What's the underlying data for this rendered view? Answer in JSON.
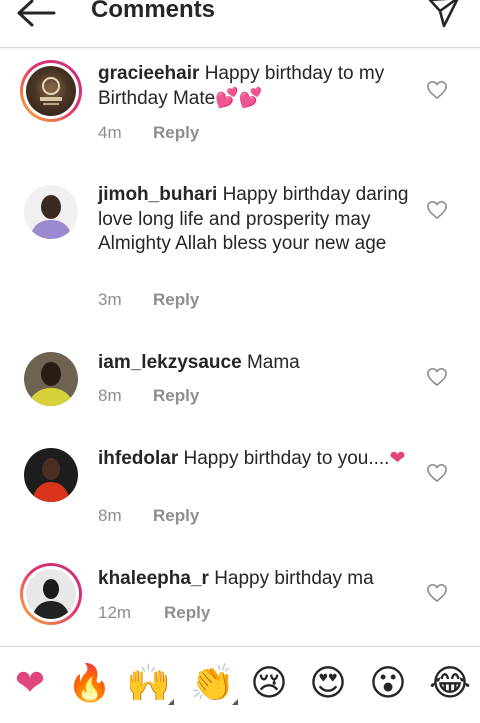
{
  "header": {
    "title": "Comments",
    "back_icon": "arrow-left-icon",
    "send_icon": "paper-plane-icon"
  },
  "comments": [
    {
      "username": "gracieehair",
      "text": "Happy birthday to my Birthday Mate",
      "emoji": "💕💕",
      "time": "4m",
      "reply_label": "Reply"
    },
    {
      "username": "jimoh_buhari",
      "text": "Happy birthday daring love long life and prosperity may Almighty Allah bless your new age",
      "emoji": "",
      "time": "3m",
      "reply_label": "Reply"
    },
    {
      "username": "iam_lekzysauce",
      "text": "Mama",
      "emoji": "",
      "time": "8m",
      "reply_label": "Reply"
    },
    {
      "username": "ihfedolar",
      "text": "Happy birthday to you....",
      "emoji": "❤",
      "time": "8m",
      "reply_label": "Reply"
    },
    {
      "username": "khaleepha_r",
      "text": "Happy birthday ma",
      "emoji": "",
      "time": "12m",
      "reply_label": "Reply"
    }
  ],
  "emoji_bar": [
    {
      "glyph": "❤",
      "name": "heart-emoji",
      "variants": false
    },
    {
      "glyph": "🔥",
      "name": "fire-emoji",
      "variants": false
    },
    {
      "glyph": "🙌",
      "name": "raised-hands-emoji",
      "variants": true
    },
    {
      "glyph": "👏",
      "name": "clapping-hands-emoji",
      "variants": true
    },
    {
      "glyph": "😢",
      "name": "sad-face-emoji",
      "variants": false
    },
    {
      "glyph": "😍",
      "name": "heart-eyes-emoji",
      "variants": false
    },
    {
      "glyph": "😮",
      "name": "surprised-face-emoji",
      "variants": false
    },
    {
      "glyph": "😂",
      "name": "laughing-face-emoji",
      "variants": false
    }
  ],
  "colors": {
    "accent_heart": "#e0457b",
    "secondary_text": "#8e8e8e",
    "primary_text": "#262626"
  }
}
